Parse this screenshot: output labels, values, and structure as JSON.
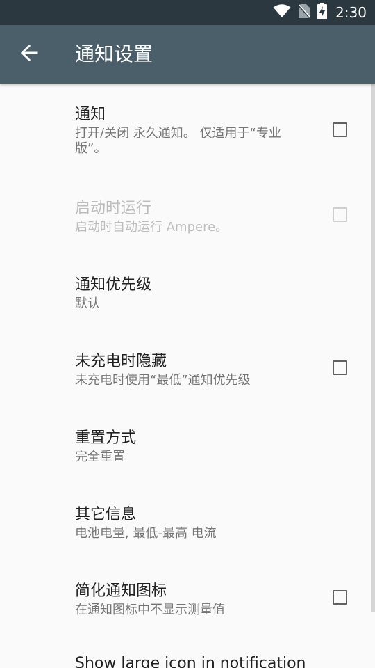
{
  "status_bar": {
    "time": "2:30",
    "icons": [
      "wifi-icon",
      "no-sim-icon",
      "battery-charging-icon"
    ]
  },
  "app_bar": {
    "title": "通知设置",
    "back_icon": "arrow-back-icon"
  },
  "preferences": [
    {
      "title": "通知",
      "summary": "打开/关闭 永久通知。 仅适用于“专业版”。",
      "checkbox": true,
      "checked": false,
      "enabled": true
    },
    {
      "title": "启动时运行",
      "summary": "启动时自动运行 Ampere。",
      "checkbox": true,
      "checked": false,
      "enabled": false
    },
    {
      "title": "通知优先级",
      "summary": "默认",
      "checkbox": false,
      "enabled": true
    },
    {
      "title": "未充电时隐藏",
      "summary": "未充电时使用“最低”通知优先级",
      "checkbox": true,
      "checked": false,
      "enabled": true
    },
    {
      "title": "重置方式",
      "summary": "完全重置",
      "checkbox": false,
      "enabled": true
    },
    {
      "title": "其它信息",
      "summary": "电池电量, 最低-最高 电流",
      "checkbox": false,
      "enabled": true
    },
    {
      "title": "简化通知图标",
      "summary": "在通知图标中不显示测量值",
      "checkbox": true,
      "checked": false,
      "enabled": true
    },
    {
      "title": "Show large icon in notification",
      "summary": "",
      "checkbox": false,
      "enabled": true
    }
  ],
  "colors": {
    "status_bar": "#2b3840",
    "app_bar": "#4a5f69",
    "background": "#fafafa",
    "title_text": "#212121",
    "summary_text": "#757575",
    "disabled_text": "#bdbdbd"
  }
}
